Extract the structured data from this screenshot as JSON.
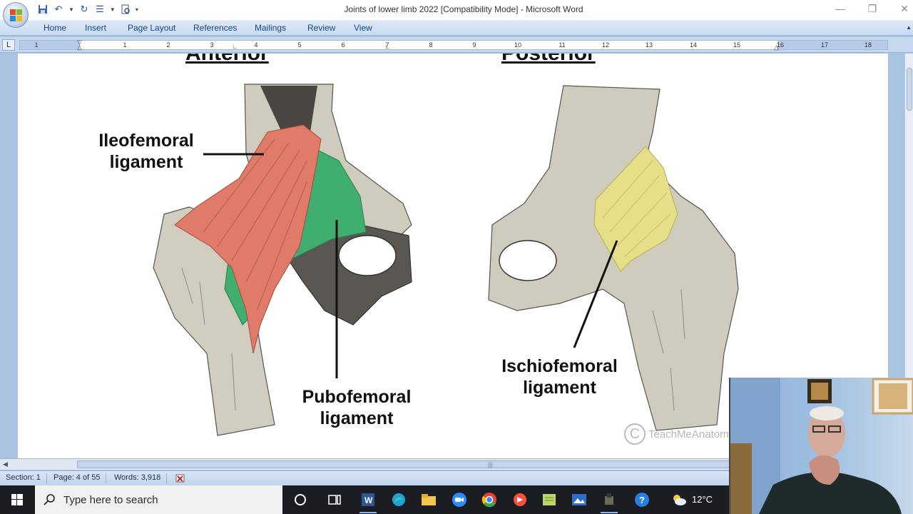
{
  "window": {
    "title": "Joints of lower limb 2022 [Compatibility Mode] - Microsoft Word",
    "minimize_icon": "—",
    "restore_icon": "❐",
    "close_icon": "✕"
  },
  "ribbon": {
    "tabs": [
      "Home",
      "Insert",
      "Page Layout",
      "References",
      "Mailings",
      "Review",
      "View"
    ]
  },
  "ruler": {
    "numbers": [
      "1",
      "1",
      "2",
      "3",
      "4",
      "5",
      "6",
      "7",
      "8",
      "9",
      "10",
      "11",
      "12",
      "13",
      "14",
      "15",
      "16",
      "17",
      "18"
    ],
    "tab_selector": "L"
  },
  "document": {
    "heading_left": "Anterior",
    "heading_right": "Posterior",
    "labels": {
      "ileofemoral_1": "Ileofemoral",
      "ileofemoral_2": "ligament",
      "pubofemoral_1": "Pubofemoral",
      "pubofemoral_2": "ligament",
      "ischiofemoral_1": "Ischiofemoral",
      "ischiofemoral_2": "ligament"
    },
    "watermark": "TeachMeAnatomy",
    "watermark_symbol": "C"
  },
  "statusbar": {
    "section": "Section: 1",
    "page": "Page: 4 of 55",
    "words": "Words: 3,918"
  },
  "taskbar": {
    "search_placeholder": "Type here to search",
    "temperature": "12°C"
  },
  "colors": {
    "ribbon_text": "#15428b",
    "ileofemoral": "#e07b6a",
    "pubofemoral": "#3fae6e",
    "ischiofemoral": "#e6df8a",
    "bone": "#cfcbbd"
  }
}
